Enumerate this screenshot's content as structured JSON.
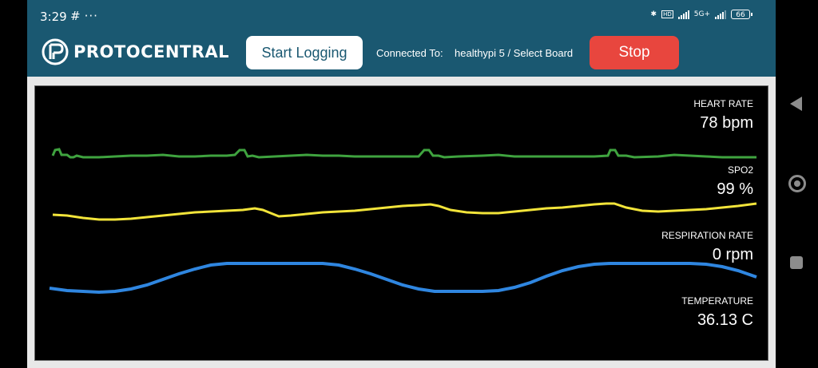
{
  "status_bar": {
    "time": "3:29",
    "left_icons": [
      "slack-icon",
      "more-dots-icon"
    ],
    "right_icons": [
      "bluetooth-icon",
      "volte-icon",
      "signal-icon",
      "5g-icon",
      "signal-icon-2"
    ],
    "network_label": "5G+",
    "battery": "66"
  },
  "header": {
    "brand": "PROTOCENTRAL",
    "start_logging_label": "Start Logging",
    "connected_label": "Connected To:",
    "connected_value": "healthypi 5 / Select Board",
    "stop_label": "Stop"
  },
  "colors": {
    "appbar": "#1a5871",
    "stop": "#e8463e",
    "heart": "#3fa33f",
    "spo2": "#f2e43a",
    "respiration": "#2f86e0"
  },
  "metrics": [
    {
      "label": "HEART RATE",
      "value": "78 bpm"
    },
    {
      "label": "SPO2",
      "value": "99 %"
    },
    {
      "label": "RESPIRATION RATE",
      "value": "0 rpm"
    },
    {
      "label": "TEMPERATURE",
      "value": "36.13 C"
    }
  ],
  "nav_bar": [
    "back-icon",
    "home-icon",
    "recent-apps-icon"
  ]
}
